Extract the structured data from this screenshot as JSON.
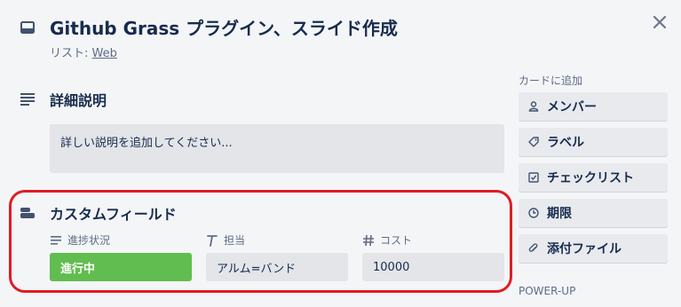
{
  "card": {
    "title": "Github Grass プラグイン、スライド作成",
    "list_prefix": "リスト: ",
    "list_name": "Web"
  },
  "description": {
    "heading": "詳細説明",
    "placeholder": "詳しい説明を追加してください..."
  },
  "custom_fields": {
    "heading": "カスタムフィールド",
    "fields": [
      {
        "label": "進捗状況",
        "value": "進行中",
        "icon": "list-lines-icon",
        "value_color": "#61bd4f"
      },
      {
        "label": "担当",
        "value": "アルム=バンド",
        "icon": "text-t-icon"
      },
      {
        "label": "コスト",
        "value": "10000",
        "icon": "hash-icon"
      }
    ]
  },
  "sidebar": {
    "heading": "カードに追加",
    "buttons": [
      {
        "label": "メンバー",
        "icon": "person-icon"
      },
      {
        "label": "ラベル",
        "icon": "tag-icon"
      },
      {
        "label": "チェックリスト",
        "icon": "checkbox-icon"
      },
      {
        "label": "期限",
        "icon": "clock-icon"
      },
      {
        "label": "添付ファイル",
        "icon": "paperclip-icon"
      }
    ],
    "powerup_heading": "POWER-UP"
  },
  "colors": {
    "background": "#f4f5f7",
    "highlight_frame": "#e01b24",
    "status_green": "#61bd4f"
  }
}
